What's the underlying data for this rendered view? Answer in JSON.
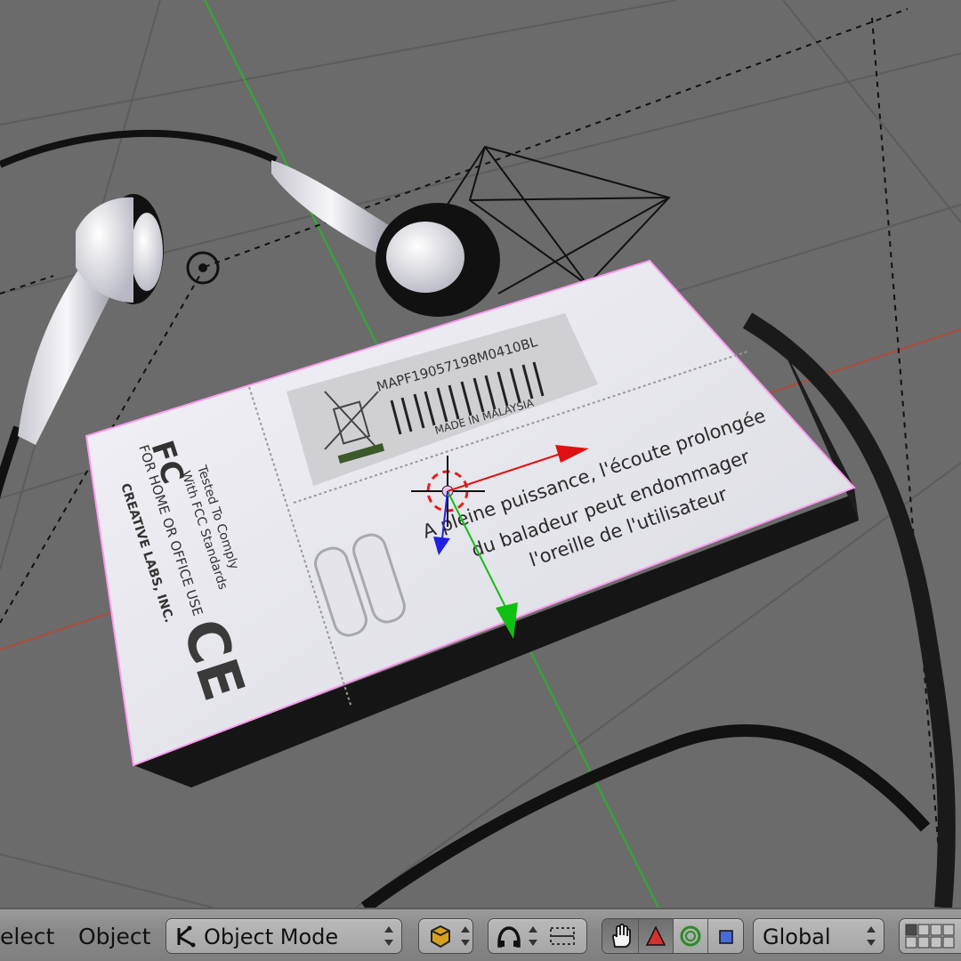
{
  "header": {
    "menu_select": "elect",
    "menu_object": "Object",
    "mode_select": {
      "value": "Object Mode",
      "icon": "object-mode-icon"
    },
    "shading_icon": "cube-shading-icon",
    "pivot_icon": "pivot-point-icon",
    "manipulator_toggle_icon": "hand-manipulator-icon",
    "translate_icon": "translate-triangle-icon",
    "rotate_icon": "rotate-ring-icon",
    "scale_icon": "scale-square-icon",
    "orientation_select": {
      "value": "Global"
    },
    "layers_icon": "layers-grid-icon"
  },
  "viewport": {
    "label_barcode": "MAPF19057198M0410BL",
    "label_made_in": "MADE IN MALAYSIA",
    "fcc_logo": "FC",
    "fcc_line1": "Tested To Comply",
    "fcc_line2": "With FCC Standards",
    "fcc_line3": "FOR HOME OR OFFICE USE",
    "fcc_line4": "CREATIVE LABS, INC.",
    "ce_mark": "CE",
    "warning_line1": "A pleine puissance, l'écoute prolongée",
    "warning_line2": "du baladeur peut endommager",
    "warning_line3": "l'oreille de l'utilisateur",
    "colors": {
      "background": "#6b6b6b",
      "x_axis": "#b04a3a",
      "y_axis": "#2fae2f",
      "selection_outline": "#ff9cf0",
      "device_body": "#e8e8ee"
    }
  }
}
